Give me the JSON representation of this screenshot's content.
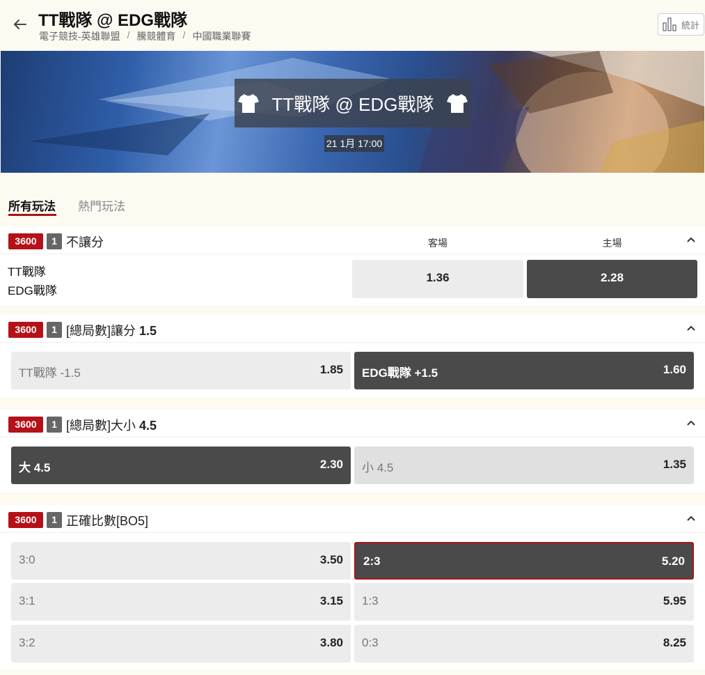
{
  "header": {
    "title": "TT戰隊 @ EDG戰隊",
    "breadcrumbs": [
      "電子競技-英雄聯盟",
      "騰競體育",
      "中國職業聯賽"
    ],
    "stats_label": "統計"
  },
  "banner": {
    "teams": "TT戰隊 @ EDG戰隊",
    "time": "21 1月 17:00"
  },
  "tabs": [
    {
      "label": "所有玩法",
      "active": true
    },
    {
      "label": "熱門玩法",
      "active": false
    }
  ],
  "markets": [
    {
      "id_badge": "3600",
      "count_badge": "1",
      "title": "不讓分",
      "columns": [
        "客場",
        "主場"
      ],
      "teams": [
        "TT戰隊",
        "EDG戰隊"
      ],
      "odds": [
        "1.36",
        "2.28"
      ]
    },
    {
      "id_badge": "3600",
      "count_badge": "1",
      "title_prefix": "[總局數]讓分",
      "title_line": "1.5",
      "options": [
        {
          "label": "TT戰隊 -1.5",
          "odds": "1.85"
        },
        {
          "label": "EDG戰隊 +1.5",
          "odds": "1.60"
        }
      ]
    },
    {
      "id_badge": "3600",
      "count_badge": "1",
      "title_prefix": "[總局數]大小",
      "title_line": "4.5",
      "options": [
        {
          "label": "大 4.5",
          "odds": "2.30"
        },
        {
          "label": "小 4.5",
          "odds": "1.35"
        }
      ]
    },
    {
      "id_badge": "3600",
      "count_badge": "1",
      "title": "正確比數[BO5]",
      "options": [
        {
          "label": "3:0",
          "odds": "3.50"
        },
        {
          "label": "2:3",
          "odds": "5.20"
        },
        {
          "label": "3:1",
          "odds": "3.15"
        },
        {
          "label": "1:3",
          "odds": "5.95"
        },
        {
          "label": "3:2",
          "odds": "3.80"
        },
        {
          "label": "0:3",
          "odds": "8.25"
        }
      ]
    }
  ],
  "colors": {
    "accent_red": "#b51119",
    "dark_button": "#4a4a4a",
    "light_button": "#ececec",
    "page_bg": "#fdfaf2"
  }
}
